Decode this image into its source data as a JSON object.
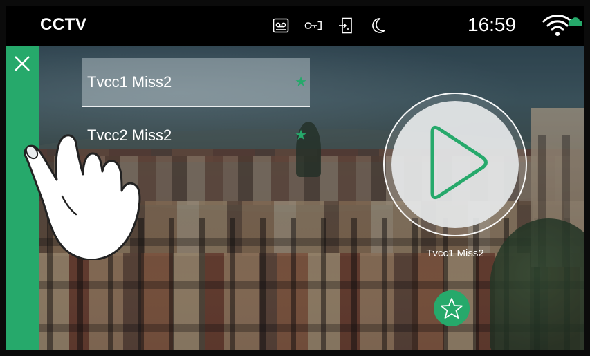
{
  "header": {
    "title": "CCTV",
    "time": "16:59",
    "status_icons": [
      "voicemail-icon",
      "door-key-icon",
      "door-exit-icon",
      "moon-icon"
    ],
    "wifi_icon": "wifi-cloud-icon"
  },
  "sidebar": {
    "close_icon": "close-icon"
  },
  "camera_list": [
    {
      "label": "Tvcc1 Miss2",
      "favorite": true,
      "selected": true
    },
    {
      "label": "Tvcc2 Miss2",
      "favorite": true,
      "selected": false
    }
  ],
  "player": {
    "caption": "Tvcc1 Miss2",
    "play_icon": "play-icon",
    "favorite_icon": "star-outline-icon"
  },
  "colors": {
    "accent": "#26a96b",
    "status_bar": "#000000"
  }
}
